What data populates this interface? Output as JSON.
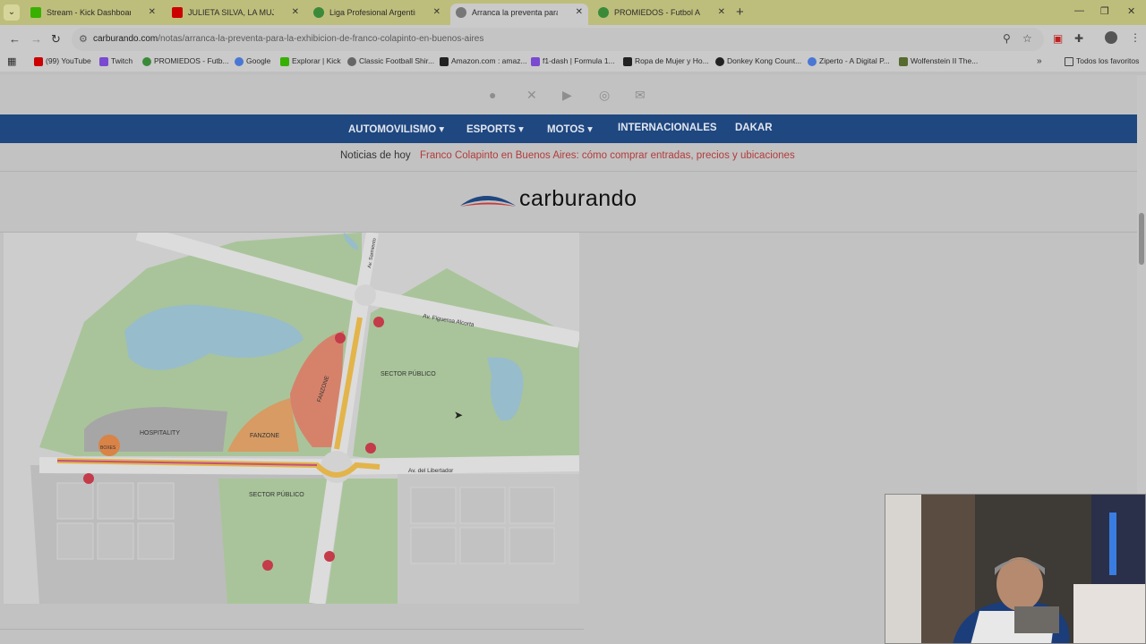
{
  "browser": {
    "tabs": [
      {
        "title": "Stream - Kick Dashboard",
        "favicon_color": "#38b000"
      },
      {
        "title": "JULIETA SILVA, LA MUJER QUE",
        "favicon_color": "#cc0000"
      },
      {
        "title": "Liga Profesional Argentina - PC",
        "favicon_color": "#3a8a3a"
      },
      {
        "title": "Arranca la preventa para la exh",
        "favicon_color": "#777777"
      },
      {
        "title": "PROMIEDOS - Futbol Argentino",
        "favicon_color": "#3a8a3a"
      }
    ],
    "url_host": "carburando.com",
    "url_path": "/notas/arranca-la-preventa-para-la-exhibicion-de-franco-colapinto-en-buenos-aires",
    "bookmarks": [
      {
        "label": "(99) YouTube",
        "color": "#cc0000"
      },
      {
        "label": "Twitch",
        "color": "#7a4ad0"
      },
      {
        "label": "PROMIEDOS - Futb...",
        "color": "#3a8a3a"
      },
      {
        "label": "Google",
        "color": "#4a77d4"
      },
      {
        "label": "Explorar | Kick",
        "color": "#38b000"
      },
      {
        "label": "Classic Football Shir...",
        "color": "#666666"
      },
      {
        "label": "Amazon.com : amaz...",
        "color": "#222222"
      },
      {
        "label": "f1-dash | Formula 1...",
        "color": "#7a4ad0"
      },
      {
        "label": "Ropa de Mujer y Ho...",
        "color": "#222222"
      },
      {
        "label": "Donkey Kong Count...",
        "color": "#222222"
      },
      {
        "label": "Ziperto - A Digital P...",
        "color": "#4a77d4"
      },
      {
        "label": "Wolfenstein II The...",
        "color": "#556b2f"
      }
    ],
    "favorites_folder": "Todos los favoritos"
  },
  "site": {
    "nav": [
      "AUTOMOVILISMO",
      "ESPORTS",
      "MOTOS",
      "INTERNACIONALES",
      "DAKAR"
    ],
    "ticker_label": "Noticias de hoy",
    "ticker_link": "Franco Colapinto en Buenos Aires: cómo comprar entradas, precios y ubicaciones",
    "logo": "carburando",
    "brand_color": "#1f4780"
  },
  "map": {
    "streets": [
      "Av. Figueroa Alcorta",
      "Av. del Libertador",
      "Av. Sarmiento"
    ],
    "zones": [
      "SECTOR PÚBLICO",
      "SECTOR PÚBLICO",
      "HOSPITALITY",
      "FANZONE",
      "FANZONE",
      "BOXES"
    ]
  }
}
